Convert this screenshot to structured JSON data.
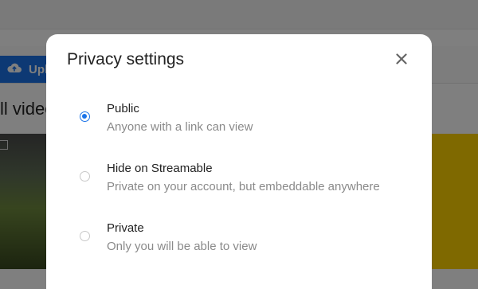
{
  "background": {
    "upload_label": "Upl",
    "section_title": "ll video"
  },
  "dialog": {
    "title": "Privacy settings",
    "close_icon": "close-icon",
    "options": [
      {
        "label": "Public",
        "description": "Anyone with a link can view",
        "selected": true
      },
      {
        "label": "Hide on Streamable",
        "description": "Private on your account, but embeddable anywhere",
        "selected": false
      },
      {
        "label": "Private",
        "description": "Only you will be able to view",
        "selected": false
      }
    ]
  },
  "colors": {
    "accent": "#1a73e8",
    "overlay": "rgba(0,0,0,0.5)",
    "thumbnail_accent": "#ffd200"
  }
}
